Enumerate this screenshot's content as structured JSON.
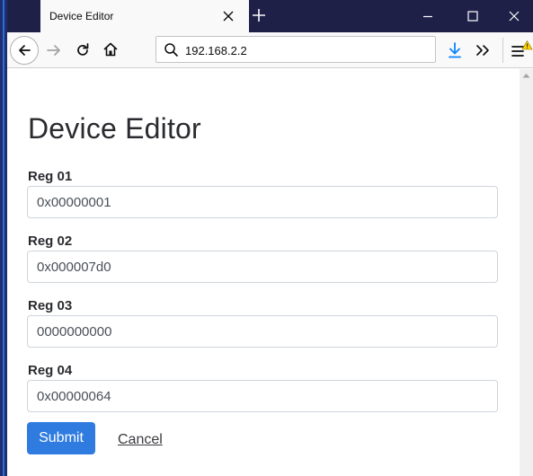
{
  "tab": {
    "title": "Device Editor",
    "close_icon": "close-icon"
  },
  "toolbar": {
    "url": "192.168.2.2"
  },
  "form": {
    "title": "Device Editor",
    "fields": [
      {
        "label": "Reg 01",
        "value": "0x00000001"
      },
      {
        "label": "Reg 02",
        "value": "0x000007d0"
      },
      {
        "label": "Reg 03",
        "value": "0000000000"
      },
      {
        "label": "Reg 04",
        "value": "0x00000064"
      }
    ],
    "submit_label": "Submit",
    "cancel_label": "Cancel"
  },
  "colors": {
    "titlebar": "#1f2048",
    "accent": "#2f7be0",
    "warning": "#ffd400"
  }
}
